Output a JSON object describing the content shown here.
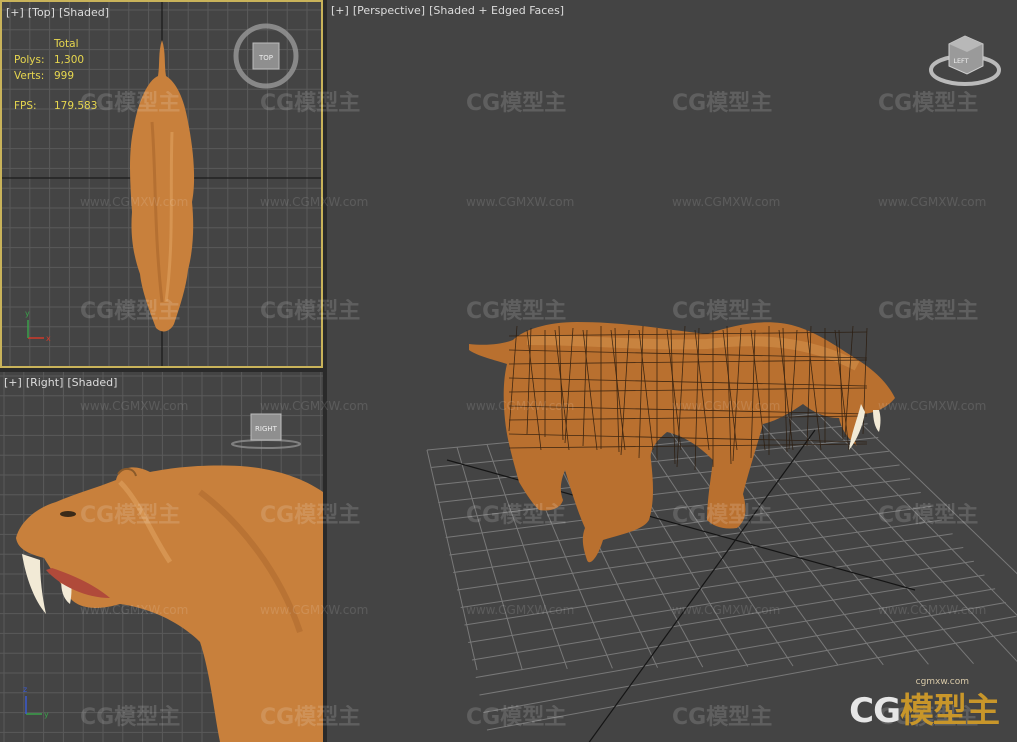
{
  "viewports": {
    "top": {
      "plus": "[+]",
      "name": "[Top]",
      "mode": "[Shaded]",
      "cube_label": "TOP"
    },
    "right": {
      "plus": "[+]",
      "name": "[Right]",
      "mode": "[Shaded]",
      "cube_label": "RIGHT"
    },
    "perspective": {
      "plus": "[+]",
      "name": "[Perspective]",
      "mode": "[Shaded + Edged Faces]",
      "cube_label": "LEFT"
    }
  },
  "stats": {
    "total_label": "Total",
    "polys_label": "Polys:",
    "polys_value": "1,300",
    "verts_label": "Verts:",
    "verts_value": "999",
    "fps_label": "FPS:",
    "fps_value": "179.583"
  },
  "watermark": {
    "logo": "CG模型主",
    "url": "www.CGMXW.com"
  },
  "corner_logo": {
    "url": "cgmxw.com",
    "text_a": "CG",
    "text_b": "模型主"
  },
  "colors": {
    "viewport_bg": "#444444",
    "active_border": "#c9b35a",
    "stats_text": "#e6d64f",
    "tiger_fur": "#c8803c"
  }
}
